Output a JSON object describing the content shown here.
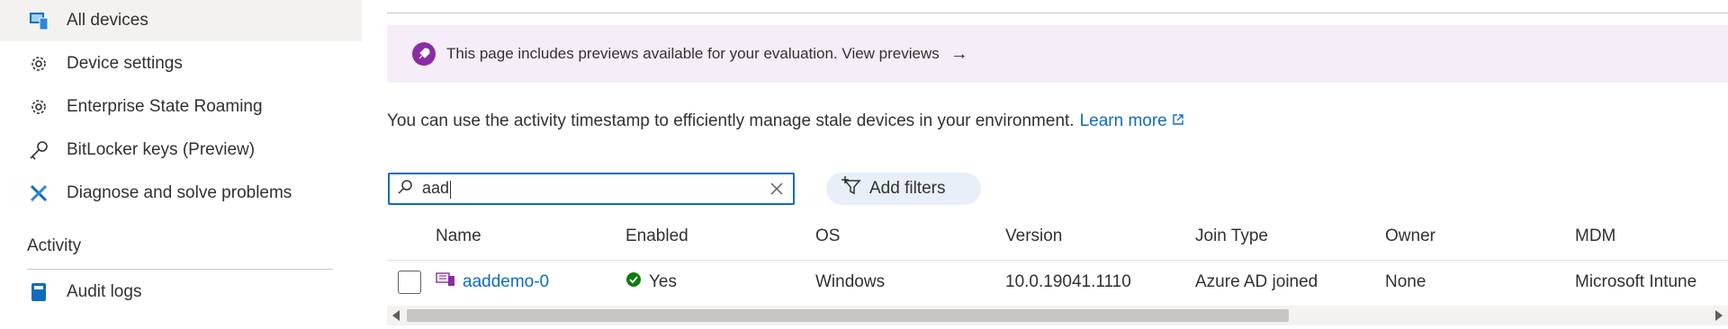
{
  "sidebar": {
    "items": [
      {
        "label": "All devices",
        "icon": "devices-icon"
      },
      {
        "label": "Device settings",
        "icon": "gear-icon"
      },
      {
        "label": "Enterprise State Roaming",
        "icon": "gear-icon"
      },
      {
        "label": "BitLocker keys (Preview)",
        "icon": "key-icon"
      },
      {
        "label": "Diagnose and solve problems",
        "icon": "wrench-icon"
      }
    ],
    "section_activity": "Activity",
    "activity_items": [
      {
        "label": "Audit logs",
        "icon": "log-icon"
      }
    ]
  },
  "banner": {
    "text": "This page includes previews available for your evaluation. View previews",
    "icon": "rocket-icon",
    "arrow": "→"
  },
  "info": {
    "text": "You can use the activity timestamp to efficiently manage stale devices in your environment.",
    "learn_more": "Learn more"
  },
  "search": {
    "value": "aad"
  },
  "toolbar": {
    "add_filters_label": "Add filters"
  },
  "table": {
    "columns": [
      "Name",
      "Enabled",
      "OS",
      "Version",
      "Join Type",
      "Owner",
      "MDM"
    ],
    "rows": [
      {
        "name": "aaddemo-0",
        "enabled": "Yes",
        "os": "Windows",
        "version": "10.0.19041.1110",
        "join_type": "Azure AD joined",
        "owner": "None",
        "mdm": "Microsoft Intune"
      }
    ]
  },
  "colors": {
    "accent": "#0f6cbd",
    "banner_bg": "#f5eef8",
    "rocket": "#8a2da5",
    "success": "#107c10"
  }
}
